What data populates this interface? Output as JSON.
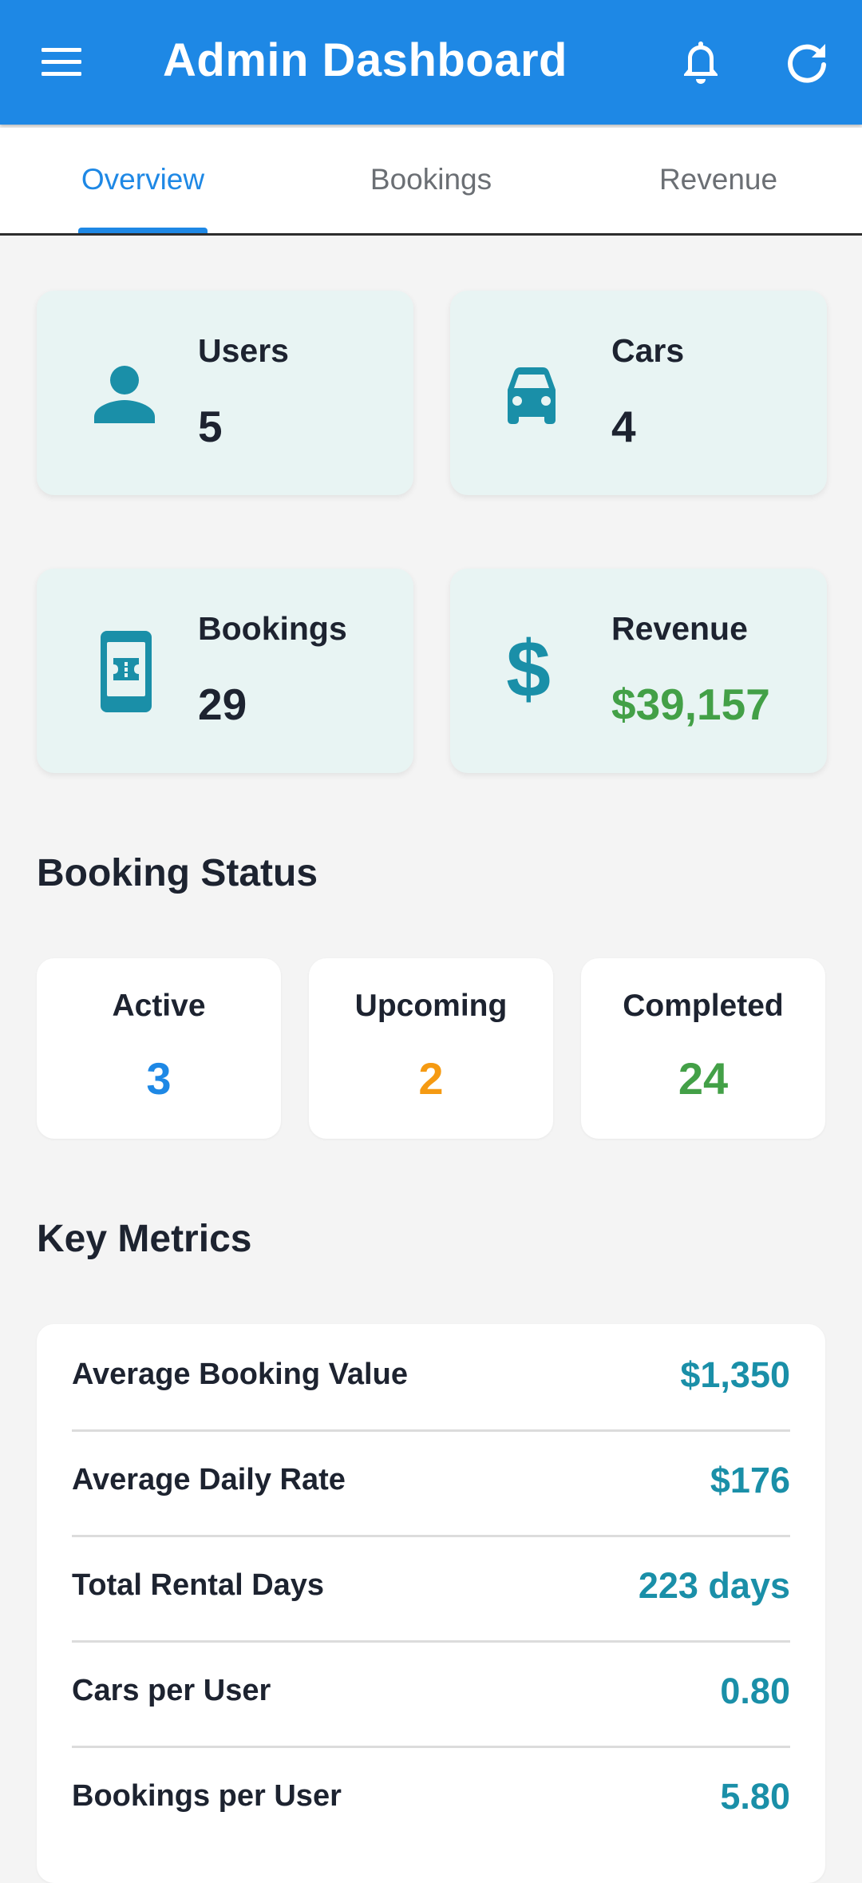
{
  "appbar": {
    "title": "Admin Dashboard",
    "icons": [
      "menu-icon",
      "bell-icon",
      "refresh-icon"
    ]
  },
  "tabs": [
    {
      "label": "Overview",
      "active": true
    },
    {
      "label": "Bookings",
      "active": false
    },
    {
      "label": "Revenue",
      "active": false
    }
  ],
  "stats": {
    "users": {
      "label": "Users",
      "value": "5",
      "icon": "person-icon"
    },
    "cars": {
      "label": "Cars",
      "value": "4",
      "icon": "car-icon"
    },
    "bookings": {
      "label": "Bookings",
      "value": "29",
      "icon": "ticket-icon"
    },
    "revenue": {
      "label": "Revenue",
      "value": "$39,157",
      "icon": "dollar-icon"
    }
  },
  "booking_status": {
    "title": "Booking Status",
    "active": {
      "label": "Active",
      "value": "3",
      "color": "#1e88e5"
    },
    "upcoming": {
      "label": "Upcoming",
      "value": "2",
      "color": "#f59a12"
    },
    "completed": {
      "label": "Completed",
      "value": "24",
      "color": "#43a047"
    }
  },
  "key_metrics": {
    "title": "Key Metrics",
    "rows": [
      {
        "label": "Average Booking Value",
        "value": "$1,350"
      },
      {
        "label": "Average Daily Rate",
        "value": "$176"
      },
      {
        "label": "Total Rental Days",
        "value": "223 days"
      },
      {
        "label": "Cars per User",
        "value": "0.80"
      },
      {
        "label": "Bookings per User",
        "value": "5.80"
      }
    ]
  },
  "colors": {
    "primary": "#1e88e5",
    "teal": "#1a8fa8",
    "green": "#43a047",
    "orange": "#f59a12",
    "card_tint": "#e8f4f3"
  }
}
